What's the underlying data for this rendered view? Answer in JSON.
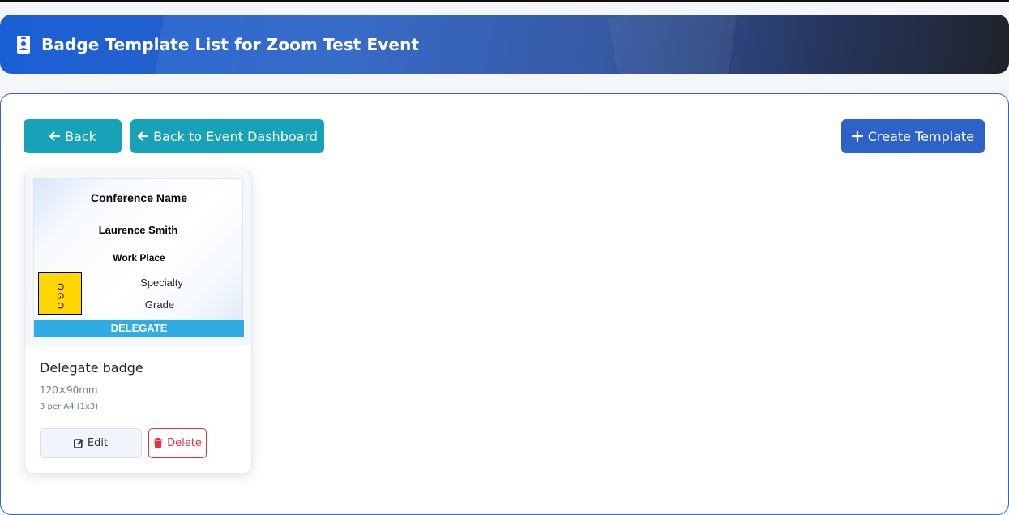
{
  "header": {
    "title": "Badge Template List for Zoom Test Event",
    "icon": "id-badge-icon"
  },
  "toolbar": {
    "back_label": "Back",
    "dashboard_label": "Back to Event Dashboard",
    "create_label": "Create Template"
  },
  "templates": [
    {
      "preview": {
        "conference": "Conference Name",
        "name": "Laurence Smith",
        "workplace": "Work Place",
        "logo": "LOGO",
        "specialty": "Specialty",
        "grade": "Grade",
        "band": "DELEGATE",
        "band_color": "#2fade3",
        "logo_color": "#ffd600"
      },
      "title": "Delegate badge",
      "size": "120×90mm",
      "layout": "3 per A4 (1x3)",
      "edit_label": "Edit",
      "delete_label": "Delete"
    }
  ],
  "colors": {
    "teal": "#17a2b8",
    "primary": "#2d63c8",
    "danger": "#dc3545"
  }
}
